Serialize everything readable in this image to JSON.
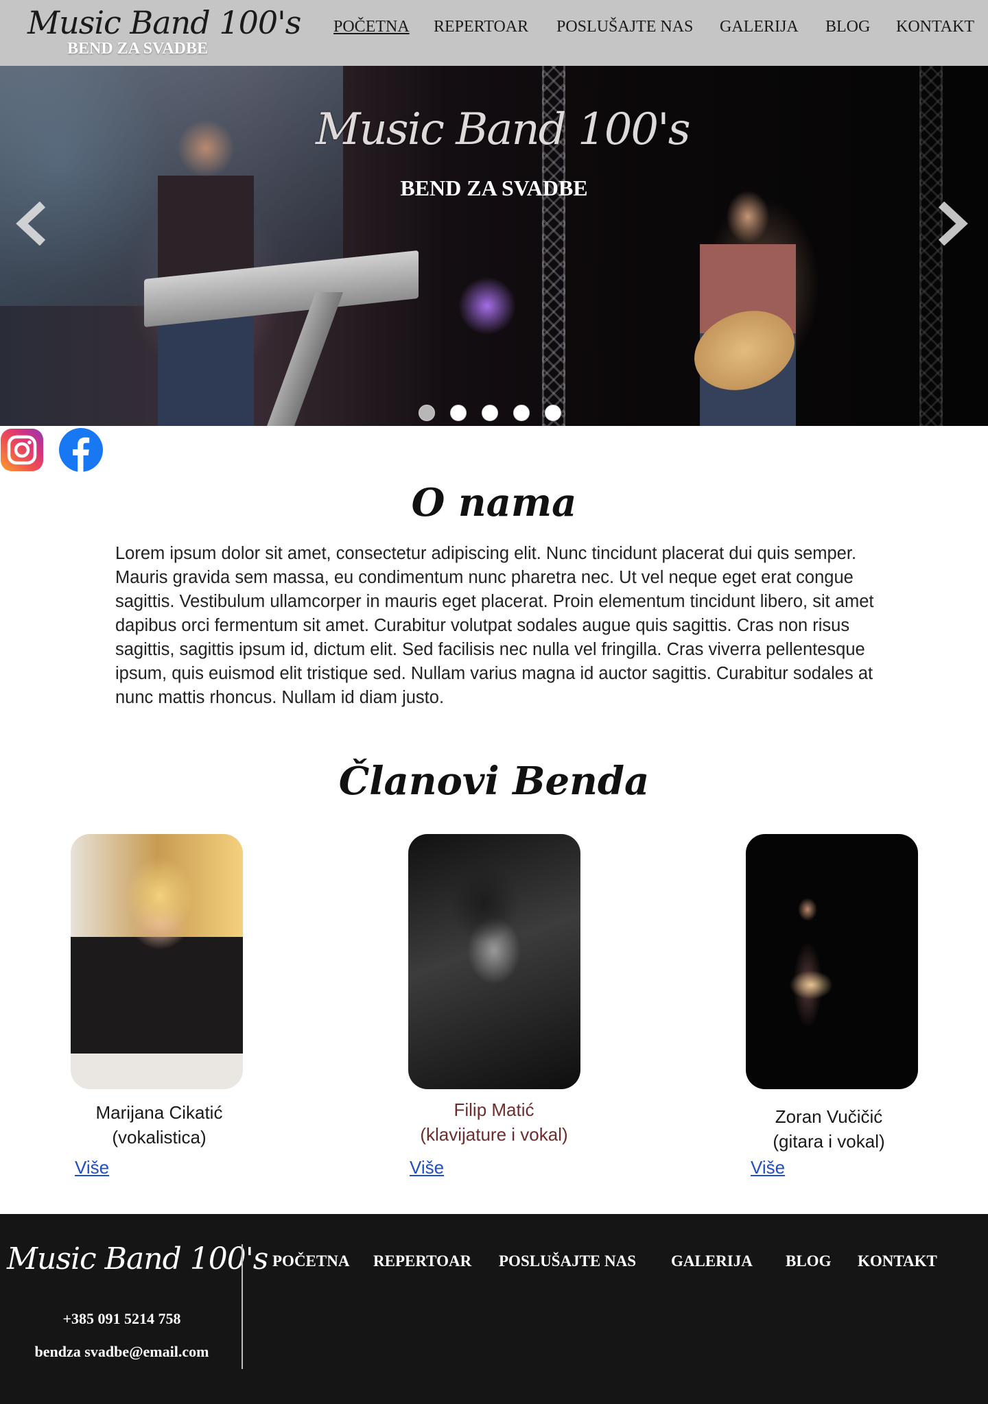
{
  "header": {
    "logo_script": "Music Band 100's",
    "logo_sub": "BEND ZA SVADBE",
    "nav": [
      "POČETNA",
      "REPERTOAR",
      "POSLUŠAJTE NAS",
      "GALERIJA",
      "BLOG",
      "KONTAKT"
    ],
    "active_nav": "POČETNA"
  },
  "hero": {
    "title": "Music Band 100's",
    "subtitle": "BEND ZA SVADBE",
    "slide_count": 5,
    "active_slide": 1,
    "prev_icon": "chevron-left-icon",
    "next_icon": "chevron-right-icon"
  },
  "social": {
    "instagram_icon": "instagram-icon",
    "facebook_icon": "facebook-icon"
  },
  "about": {
    "title": "O nama",
    "text": "Lorem ipsum dolor sit amet, consectetur adipiscing elit. Nunc tincidunt placerat dui quis semper. Mauris gravida sem massa, eu condimentum nunc pharetra nec. Ut vel neque eget erat congue sagittis. Vestibulum ullamcorper in mauris eget placerat. Proin elementum tincidunt libero, sit amet dapibus orci fermentum sit amet. Curabitur volutpat sodales augue quis sagittis. Cras non risus sagittis, sagittis ipsum id, dictum elit. Sed facilisis nec nulla vel fringilla. Cras viverra pellentesque ipsum, quis euismod elit tristique sed. Nullam varius magna id auctor sagittis. Curabitur sodales at nunc mattis rhoncus. Nullam id diam justo."
  },
  "members": {
    "title": "Članovi Benda",
    "items": [
      {
        "name": "Marijana Cikatić",
        "role": "(vokalistica)",
        "more": "Više"
      },
      {
        "name": "Filip Matić",
        "role": "(klavijature i vokal)",
        "more": "Više"
      },
      {
        "name": "Zoran Vučičić",
        "role": "(gitara i vokal)",
        "more": "Više"
      }
    ]
  },
  "footer": {
    "logo": "Music Band 100's",
    "phone": "+385 091 5214 758",
    "email": "bendza svadbe@email.com",
    "nav": [
      "POČETNA",
      "REPERTOAR",
      "POSLUŠAJTE NAS",
      "GALERIJA",
      "BLOG",
      "KONTAKT"
    ]
  },
  "colors": {
    "header_bg": "#c5c5c5",
    "footer_bg": "#151515",
    "link": "#1f4fc2",
    "highlight_name": "#6f2c2c"
  }
}
